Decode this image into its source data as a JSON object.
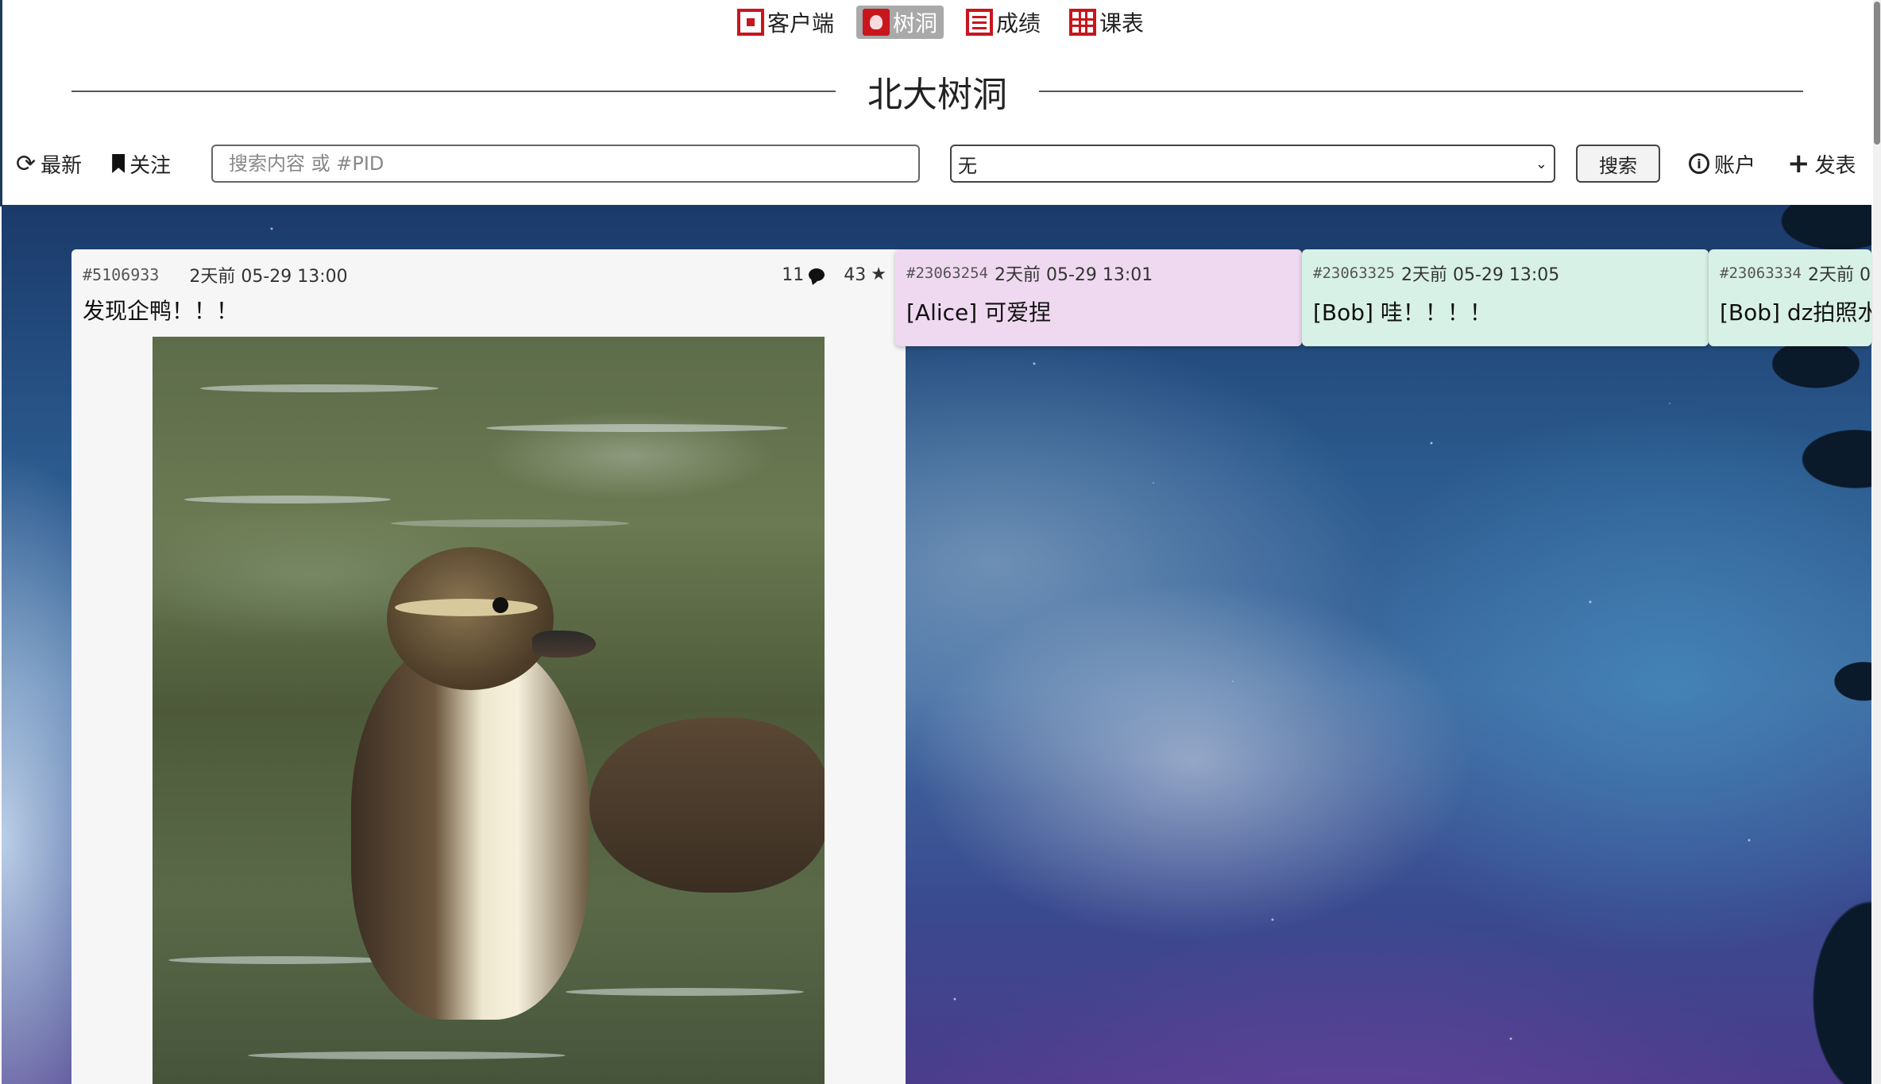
{
  "nav": {
    "items": [
      {
        "label": "客户端",
        "icon": "qr-code-icon"
      },
      {
        "label": "树洞",
        "icon": "treehole-icon",
        "active": true
      },
      {
        "label": "成绩",
        "icon": "grade-icon"
      },
      {
        "label": "课表",
        "icon": "timetable-icon"
      }
    ]
  },
  "header": {
    "title": "北大树洞"
  },
  "toolbar": {
    "refresh_label": "最新",
    "follow_label": "关注",
    "search_placeholder": "搜索内容 或 #PID",
    "filter_value": "无",
    "search_button": "搜索",
    "account_label": "账户",
    "post_label": "发表"
  },
  "colors": {
    "accent_red": "#c8161d",
    "reply_alice_bg": "#efd9f0",
    "reply_bob_bg": "#d8f1e6"
  },
  "post": {
    "pid": "#5106933",
    "time": "2天前  05-29 13:00",
    "reply_count": "11",
    "star_count": "43",
    "text": "发现企鸭！！！"
  },
  "replies": [
    {
      "pid": "#23063254",
      "time": "2天前 05-29 13:01",
      "text": "[Alice] 可爱捏"
    },
    {
      "pid": "#23063325",
      "time": "2天前 05-29 13:05",
      "text": "[Bob] 哇！！！！"
    },
    {
      "pid": "#23063334",
      "time": "2天前 0",
      "text": "[Bob] dz拍照水"
    }
  ]
}
